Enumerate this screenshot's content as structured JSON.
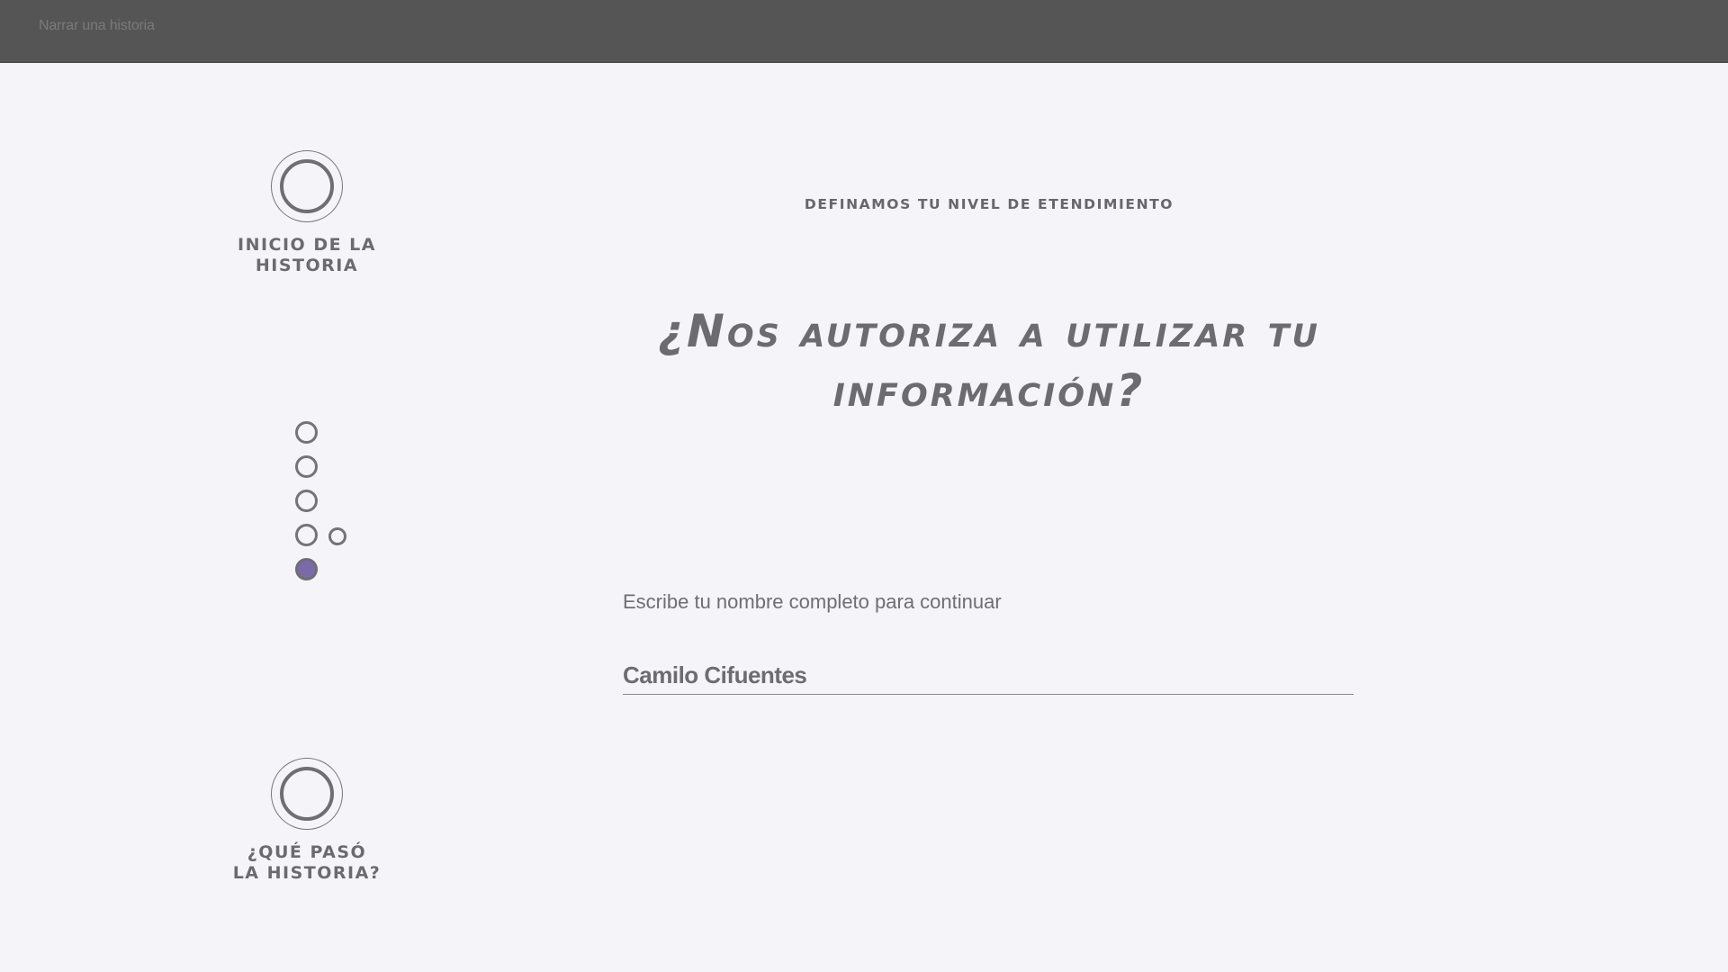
{
  "header": {
    "title": "Narrar una historia"
  },
  "steps": {
    "start_label": "INICIO DE LA\nHISTORIA",
    "end_label": "¿QUÉ PASÓ\nLA HISTORIA?",
    "current_step": 5,
    "total_steps": 5
  },
  "main": {
    "subheading": "DEFINAMOS TU NIVEL DE ETENDIMIENTO",
    "question": "¿Nos autoriza a utilizar tu información?",
    "instruction": "Escribe tu nombre completo para continuar",
    "name_value": "Camilo Cifuentes"
  },
  "colors": {
    "topbar": "#555555",
    "background": "#f5f4f8",
    "accent": "#7b69a8",
    "text": "#6b6b70"
  }
}
